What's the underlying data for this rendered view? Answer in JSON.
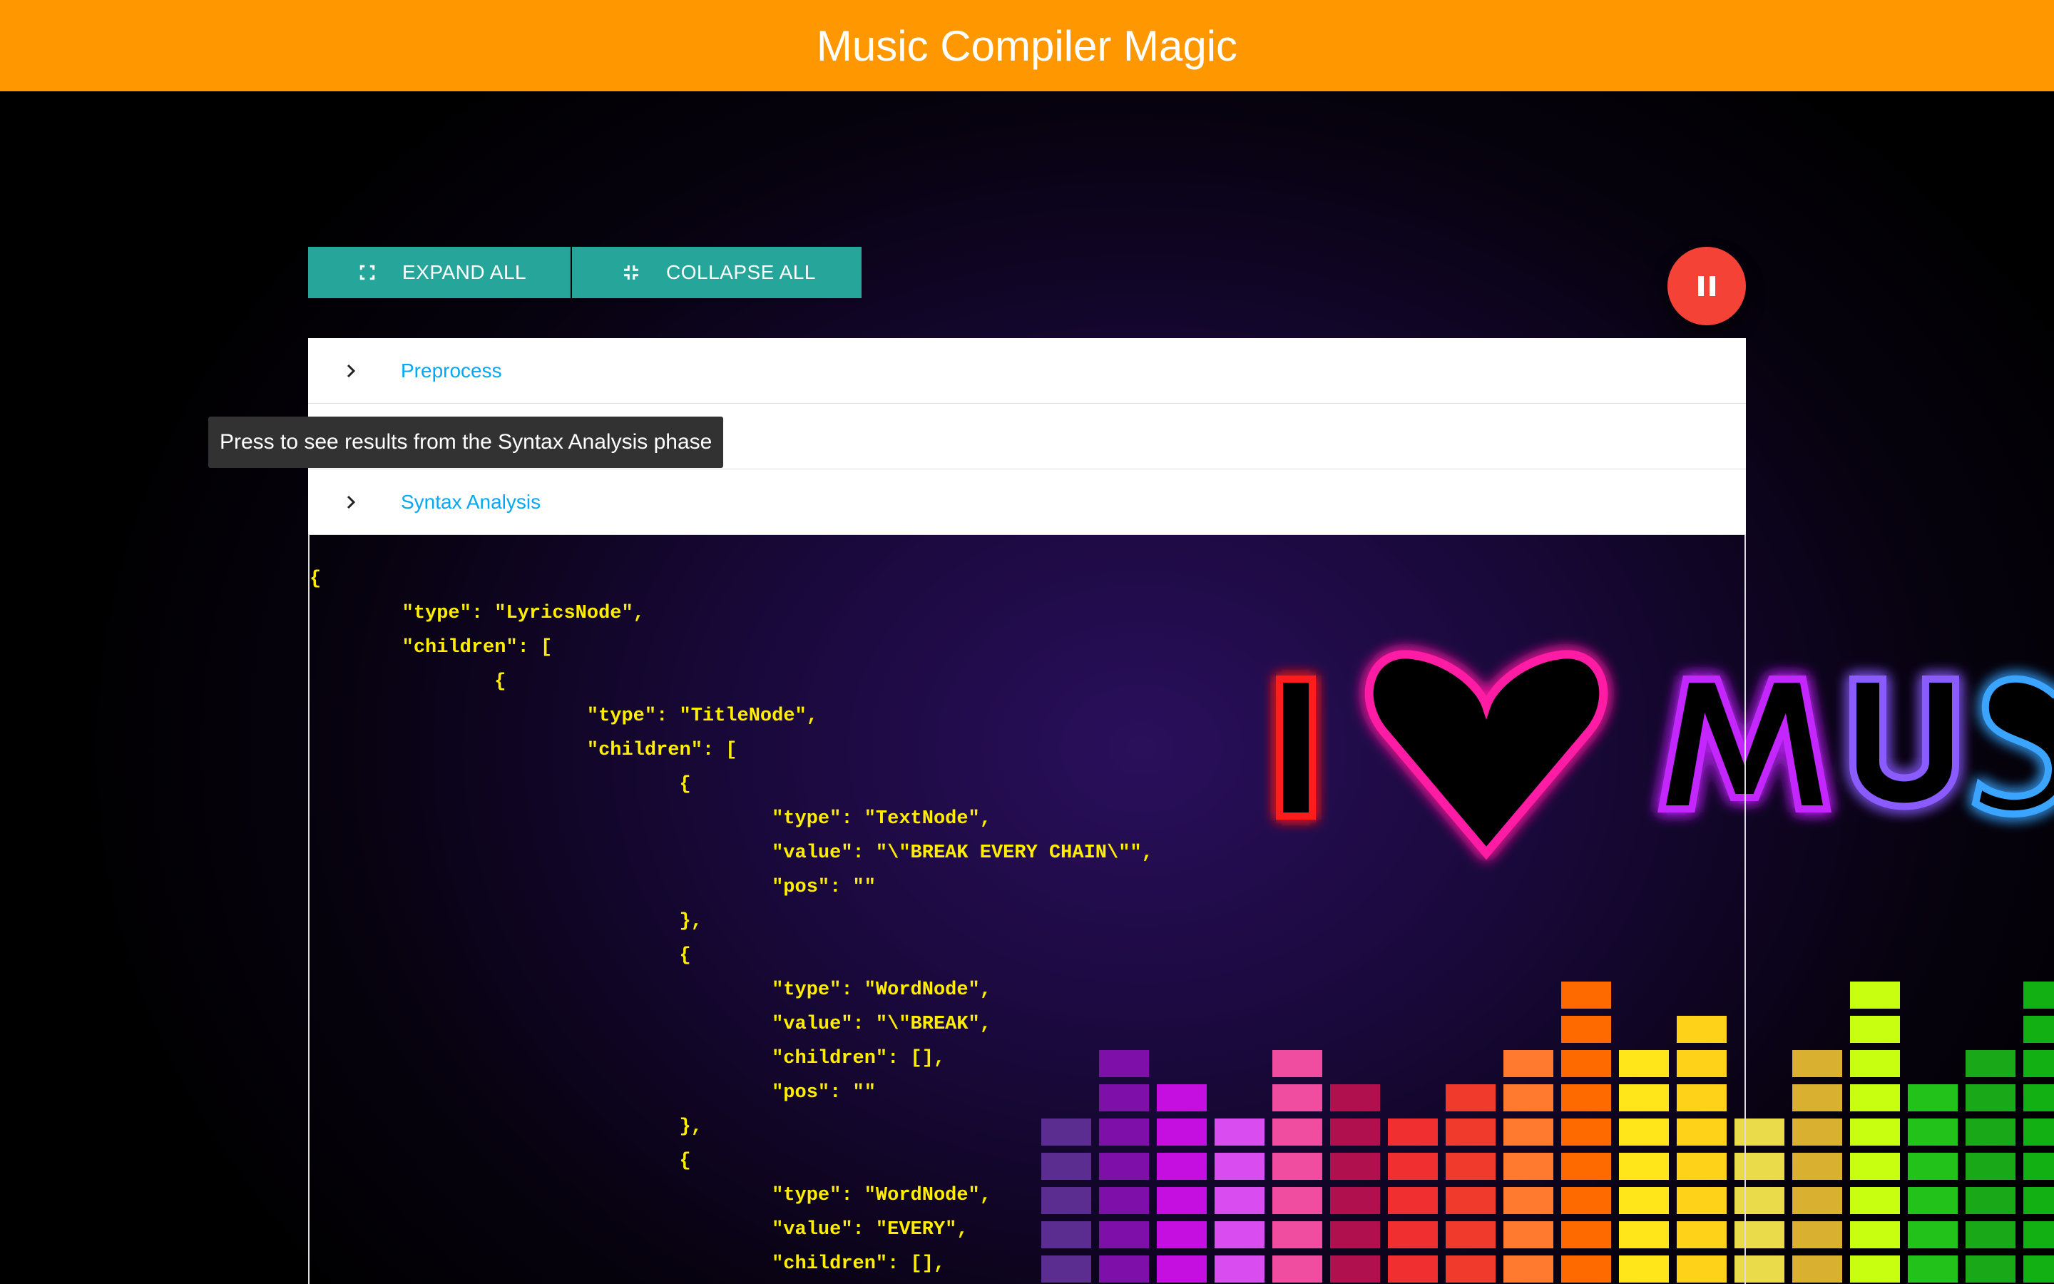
{
  "app": {
    "title": "Music Compiler Magic"
  },
  "toolbar": {
    "expand_label": "EXPAND ALL",
    "collapse_label": "COLLAPSE ALL"
  },
  "panels": [
    {
      "label": "Preprocess"
    },
    {
      "label": ""
    },
    {
      "label": "Syntax Analysis"
    }
  ],
  "tooltip": {
    "text": "Press to see results from the Syntax Analysis phase"
  },
  "code": {
    "text": "{\n\t\"type\": \"LyricsNode\",\n\t\"children\": [\n\t\t{\n\t\t\t\"type\": \"TitleNode\",\n\t\t\t\"children\": [\n\t\t\t\t{\n\t\t\t\t\t\"type\": \"TextNode\",\n\t\t\t\t\t\"value\": \"\\\"BREAK EVERY CHAIN\\\"\",\n\t\t\t\t\t\"pos\": \"\"\n\t\t\t\t},\n\t\t\t\t{\n\t\t\t\t\t\"type\": \"WordNode\",\n\t\t\t\t\t\"value\": \"\\\"BREAK\",\n\t\t\t\t\t\"children\": [],\n\t\t\t\t\t\"pos\": \"\"\n\t\t\t\t},\n\t\t\t\t{\n\t\t\t\t\t\"type\": \"WordNode\",\n\t\t\t\t\t\"value\": \"EVERY\",\n\t\t\t\t\t\"children\": [],"
  },
  "background": {
    "banner_text": "I ♥ MUSIC",
    "heart": "♥"
  },
  "icons": {
    "expand": "fullscreen-icon",
    "collapse": "fullscreen-exit-icon",
    "pause": "pause-icon",
    "chevron": "chevron-right-icon"
  },
  "colors": {
    "topbar": "#ff9800",
    "button": "#26a69a",
    "fab": "#f44336",
    "panel_label": "#03a9f4",
    "code_text": "#ffee00"
  }
}
